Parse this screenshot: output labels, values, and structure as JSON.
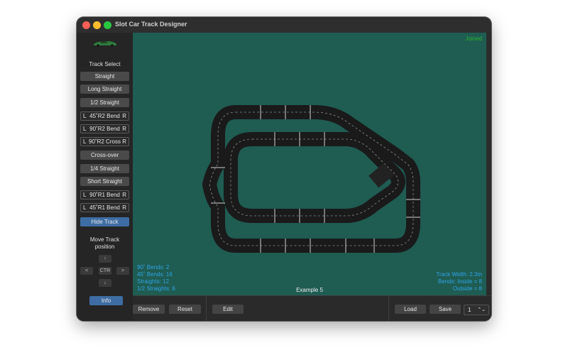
{
  "window": {
    "title": "Slot Car Track Designer"
  },
  "sidebar": {
    "track_select_label": "Track Select",
    "buttons": [
      {
        "label": "Straight",
        "lr": false
      },
      {
        "label": "Long Straight",
        "lr": false
      },
      {
        "label": "1/2 Straight",
        "lr": false
      },
      {
        "label": "45˚R2 Bend",
        "lr": true,
        "left": "L",
        "right": "R"
      },
      {
        "label": "90˚R2 Bend",
        "lr": true,
        "left": "L",
        "right": "R"
      },
      {
        "label": "90˚R2 Cross",
        "lr": true,
        "left": "L",
        "right": "R"
      },
      {
        "label": "Cross-over",
        "lr": false
      },
      {
        "label": "1/4 Straight",
        "lr": false
      },
      {
        "label": "Short Straight",
        "lr": false
      },
      {
        "label": "90˚R1 Bend",
        "lr": true,
        "left": "L",
        "right": "R"
      },
      {
        "label": "45˚R1 Bend",
        "lr": true,
        "left": "L",
        "right": "R"
      }
    ],
    "hide_track_label": "Hide Track",
    "move_label": "Move Track position",
    "move_buttons": {
      "up": "↑",
      "left": "<",
      "center": "CTR",
      "right": ">",
      "down": "↓"
    },
    "info_label": "Info"
  },
  "canvas": {
    "status": "Joined",
    "stats_left": [
      "90˚ Bends: 2",
      "45˚ Bends: 16",
      "Straights: 12",
      "1/2 Straights: 6"
    ],
    "stats_right": [
      "Track Width: 2.3m",
      "Bends: Inside = 8",
      "Outside = 8"
    ],
    "example_label": "Example 5"
  },
  "bottombar": {
    "remove_label": "Remove",
    "reset_label": "Reset",
    "edit_label": "Edit",
    "load_label": "Load",
    "save_label": "Save",
    "stepper_value": "1"
  },
  "colors": {
    "canvas_bg": "#1f5c52",
    "accent": "#3d6da4",
    "stats": "#2fa4e6",
    "joined": "#2db52d"
  }
}
